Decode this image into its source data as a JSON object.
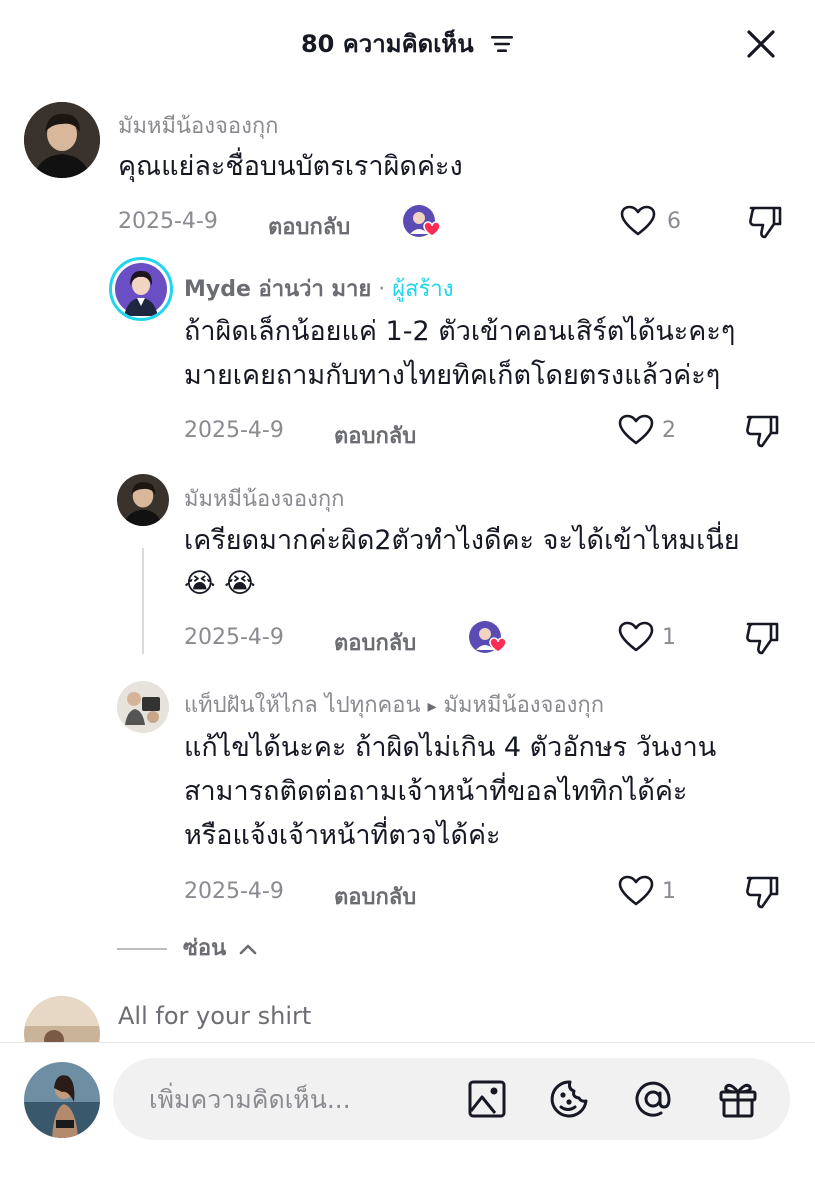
{
  "header": {
    "title": "80 ความคิดเห็น"
  },
  "comments": [
    {
      "username": "มัมหมีน้องจองกุก",
      "text": "คุณแย่ละชื่อบนบัตรเราผิดค่ะง",
      "date": "2025-4-9",
      "reply_label": "ตอบกลับ",
      "likes": "6",
      "liked_by_creator": true
    },
    {
      "username": "Myde อ่านว่า มาย",
      "separator": "·",
      "creator_badge": "ผู้สร้าง",
      "text_lines": [
        "ถ้าผิดเล็กน้อยแค่ 1-2 ตัวเข้าคอนเสิร์ตได้นะคะๆ",
        "มายเคยถามกับทางไทยทิคเก็ตโดยตรงแล้วค่ะๆ"
      ],
      "date": "2025-4-9",
      "reply_label": "ตอบกลับ",
      "likes": "2"
    },
    {
      "username": "มัมหมีน้องจองกุก",
      "text_lines": [
        "เครียดมากค่ะผิด2ตัวทำไงดีคะ จะได้เข้าไหมเนี่ย",
        "😭 😭"
      ],
      "date": "2025-4-9",
      "reply_label": "ตอบกลับ",
      "likes": "1",
      "liked_by_creator": true
    },
    {
      "username": "แท็ปฝันให้ไกล ไปทุกคอน",
      "reply_arrow": "▸",
      "reply_to": "มัมหมีน้องจองกุก",
      "text_lines": [
        "แก้ไขได้นะคะ ถ้าผิดไม่เกิน 4 ตัวอักษร วันงาน",
        "สามารถติดต่อถามเจ้าหน้าที่ขอลไททิกได้ค่ะ",
        "หรือแจ้งเจ้าหน้าที่ตวจได้ค่ะ"
      ],
      "date": "2025-4-9",
      "reply_label": "ตอบกลับ",
      "likes": "1"
    },
    {
      "username": "All for your shirt"
    }
  ],
  "hide_replies": {
    "label": "ซ่อน"
  },
  "input": {
    "placeholder": "เพิ่มความคิดเห็น..."
  },
  "icons": [
    "filter-icon",
    "close-icon",
    "heart-icon",
    "dislike-icon",
    "image-icon",
    "emoji-icon",
    "mention-icon",
    "gift-icon",
    "chevron-up-icon"
  ],
  "colors": {
    "text": "#161823",
    "muted": "#8a8b91",
    "creator": "#20d5ec",
    "liked_badge": "#fe2c55"
  }
}
